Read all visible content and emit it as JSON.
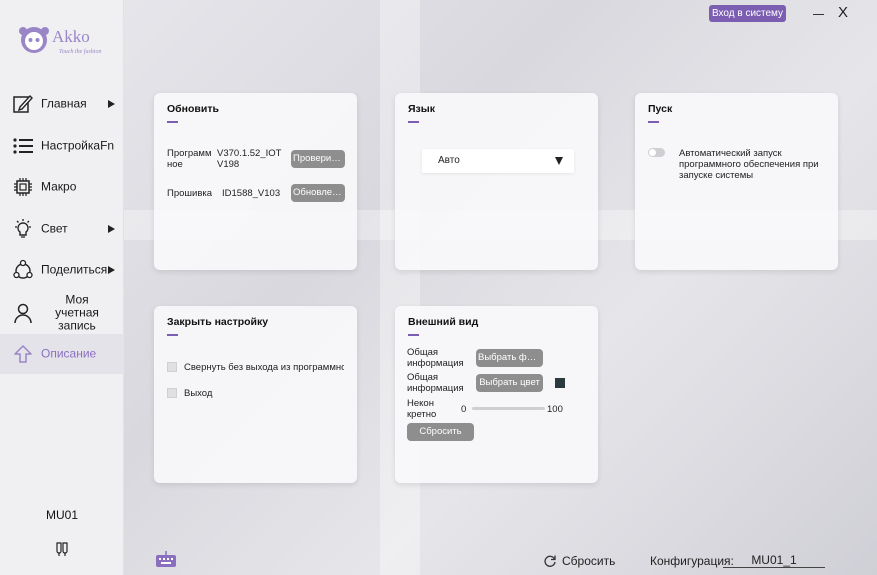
{
  "header": {
    "login_label": "Вход в систему",
    "minimize": "—",
    "close": "X"
  },
  "logo": {
    "brand": "Akko",
    "tagline": "Touch the fashion"
  },
  "sidebar": {
    "items": [
      {
        "label": "Главная",
        "icon": "edit-icon",
        "has_arrow": true
      },
      {
        "label": "НастройкаFn",
        "icon": "list-icon",
        "has_arrow": false
      },
      {
        "label": "Макро",
        "icon": "chip-icon",
        "has_arrow": false
      },
      {
        "label": "Свет",
        "icon": "bulb-icon",
        "has_arrow": true
      },
      {
        "label": "Поделиться",
        "icon": "share-icon",
        "has_arrow": true
      },
      {
        "label": "Моя учетная\nзапись",
        "icon": "user-icon",
        "has_arrow": false
      },
      {
        "label": "Описание",
        "icon": "upload-icon",
        "has_arrow": false,
        "active": true
      }
    ],
    "profile_name": "MU01"
  },
  "update_card": {
    "title": "Обновить",
    "software_label": "Программное",
    "software_version": "V370.1.52_IOTV198",
    "check_button": "Проверить ...",
    "firmware_label": "Прошивка",
    "firmware_version": "ID1588_V103",
    "update_button": "Обновление"
  },
  "language_card": {
    "title": "Язык",
    "selected": "Авто"
  },
  "startup_card": {
    "title": "Пуск",
    "toggle_on": false,
    "description": "Автоматический запуск программного обеспечения при запуске системы"
  },
  "close_card": {
    "title": "Закрыть настройку",
    "options": [
      "Свернуть без выхода из программног...",
      "Выход"
    ]
  },
  "appearance_card": {
    "title": "Внешний вид",
    "row1_label": "Общая информация",
    "row1_button": "Выбрать фото...",
    "row2_label": "Общая информация",
    "row2_button": "Выбрать цвет",
    "color": "#2b3a3f",
    "opacity_label": "Неконкретно",
    "opacity_min": "0",
    "opacity_max": "100",
    "opacity_value": 0,
    "reset_button": "Сбросить"
  },
  "footer": {
    "reset_label": "Сбросить",
    "config_label": "Конфигурация:",
    "config_value": "MU01_1"
  },
  "colors": {
    "accent": "#7b5eb2",
    "active_text": "#8a6fc0",
    "button_gray": "#8e8e8e"
  }
}
